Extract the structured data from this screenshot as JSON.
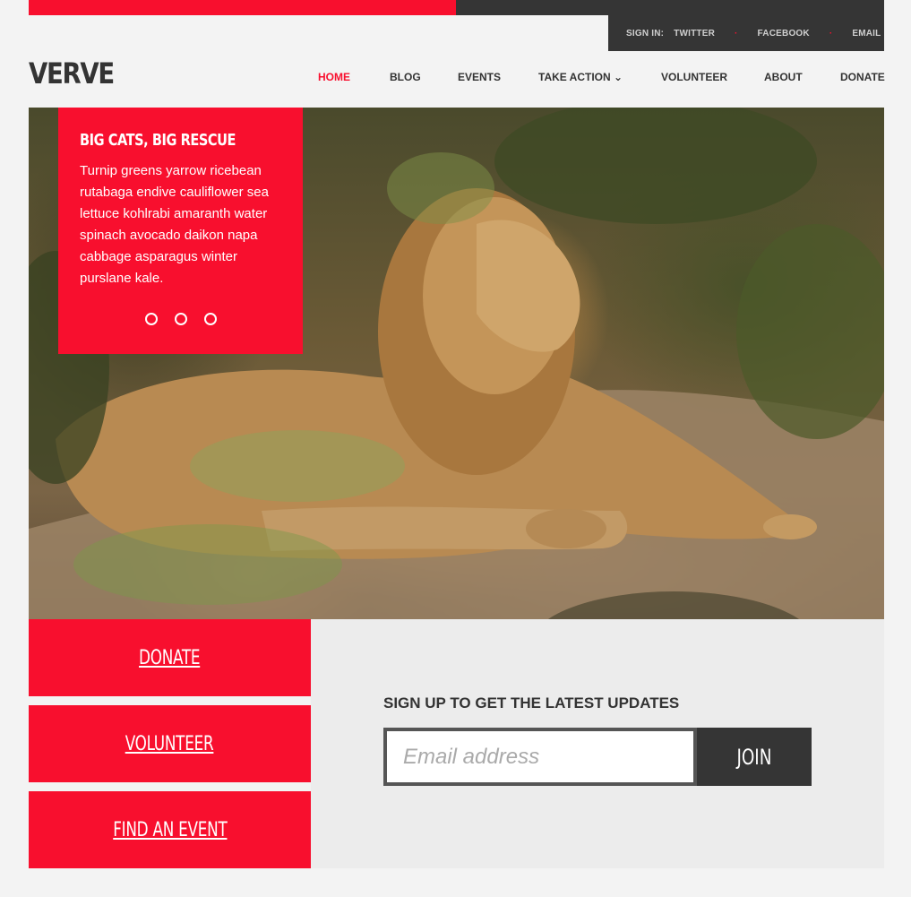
{
  "topbar": {
    "signin_label": "SIGN IN:",
    "links": [
      "TWITTER",
      "FACEBOOK",
      "EMAIL"
    ],
    "separator": "·"
  },
  "brand": {
    "logo": "VERVE"
  },
  "nav": {
    "items": [
      "HOME",
      "BLOG",
      "EVENTS",
      "TAKE ACTION ⌄",
      "VOLUNTEER",
      "ABOUT",
      "DONATE"
    ],
    "active": "HOME"
  },
  "hero": {
    "title": "BIG CATS, BIG RESCUE",
    "text": "Turnip greens yarrow ricebean rutabaga endive cauliflower sea lettuce kohlrabi amaranth water spinach avocado daikon napa cabbage asparagus winter purslane kale.",
    "slides": 3
  },
  "tiles": [
    "DONATE",
    "VOLUNTEER",
    "FIND AN EVENT"
  ],
  "signup": {
    "heading": "SIGN UP TO GET THE LATEST UPDATES",
    "placeholder": "Email address",
    "button": "JOIN"
  },
  "colors": {
    "accent": "#f80f2e",
    "dark": "#353535",
    "background": "#f3f3f3"
  }
}
